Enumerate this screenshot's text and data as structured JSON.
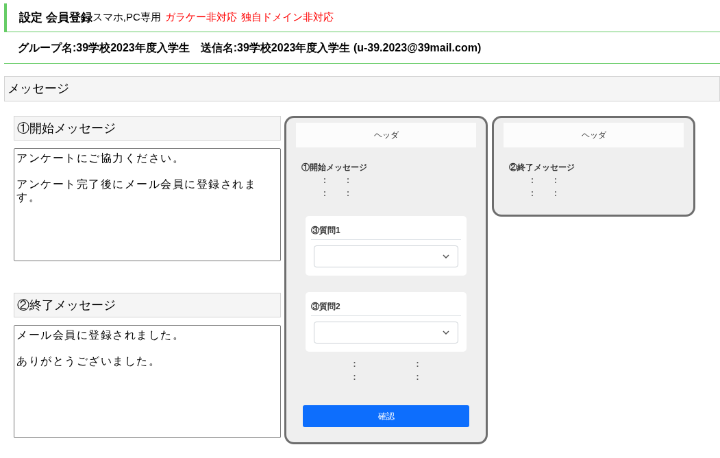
{
  "title": {
    "main": "設定 会員登録",
    "sub": "スマホ,PC専用",
    "warnings": [
      "ガラケー非対応",
      "独自ドメイン非対応"
    ]
  },
  "group_line": "グループ名:39学校2023年度入学生　送信名:39学校2023年度入学生 (u-39.2023@39mail.com)",
  "section_title": "メッセージ",
  "messages": [
    {
      "label": "①開始メッセージ",
      "paragraphs": [
        "アンケートにご協力ください。",
        "アンケート完了後にメール会員に登録されます。"
      ]
    },
    {
      "label": "②終了メッセージ",
      "paragraphs": [
        "メール会員に登録されました。",
        "ありがとうございました。"
      ]
    }
  ],
  "previews": [
    {
      "header": "ヘッダ",
      "blocks": [
        {
          "kind": "text",
          "text": "①開始メッセージ"
        },
        {
          "kind": "dots",
          "rows": [
            [
              ":",
              ":"
            ],
            [
              ":",
              ":"
            ]
          ]
        },
        {
          "kind": "question",
          "label": "③質問1"
        },
        {
          "kind": "question",
          "label": "③質問2"
        },
        {
          "kind": "wide_dots",
          "rows": [
            [
              ":",
              ":"
            ],
            [
              ":",
              ":"
            ]
          ]
        },
        {
          "kind": "button",
          "label": "確認"
        }
      ]
    },
    {
      "header": "ヘッダ",
      "blocks": [
        {
          "kind": "text",
          "text": "②終了メッセージ"
        },
        {
          "kind": "dots",
          "rows": [
            [
              ":",
              ":"
            ],
            [
              ":",
              ":"
            ]
          ]
        }
      ]
    }
  ]
}
